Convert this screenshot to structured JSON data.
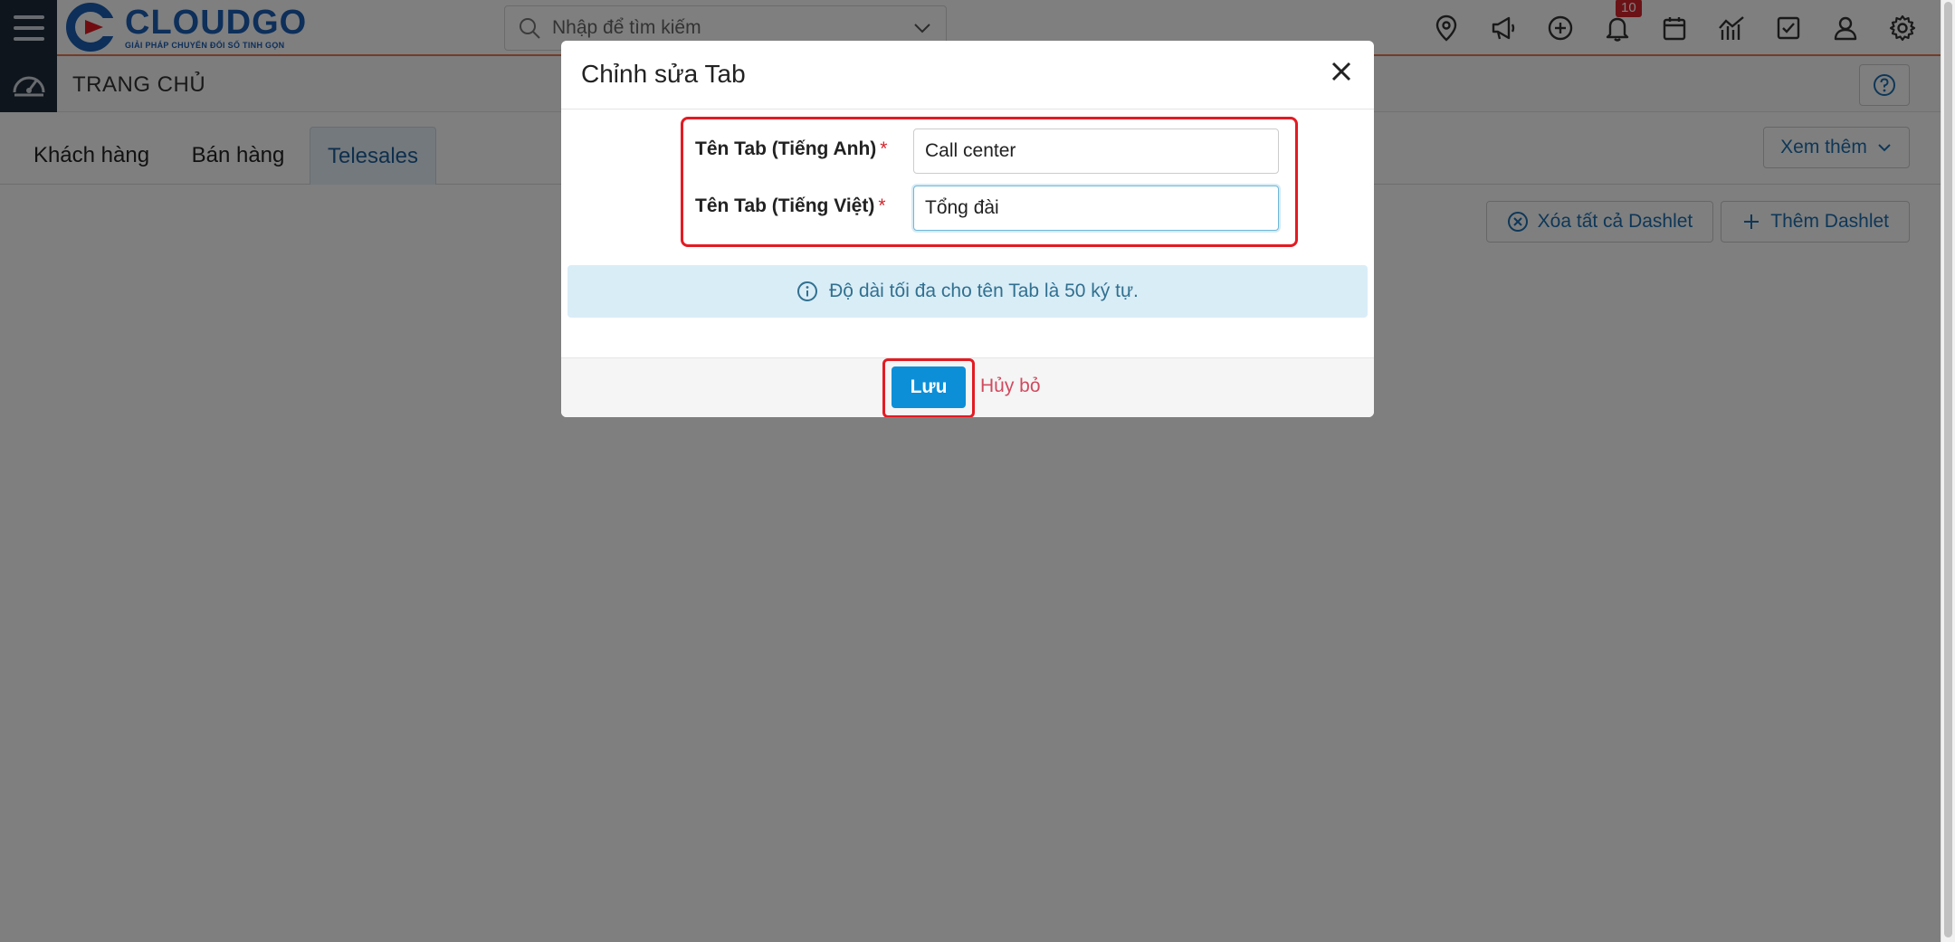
{
  "header": {
    "logo_name": "CLOUDGO",
    "logo_tagline": "GIẢI PHÁP CHUYỂN ĐỔI SỐ TINH GỌN",
    "search_placeholder": "Nhập để tìm kiếm",
    "notification_count": "10",
    "icons": [
      "map-pin-icon",
      "megaphone-icon",
      "plus-circle-icon",
      "bell-icon",
      "calendar-icon",
      "chart-icon",
      "checkbox-icon",
      "user-icon",
      "gear-icon"
    ]
  },
  "breadcrumb": {
    "title": "TRANG CHỦ"
  },
  "tabs": [
    {
      "label": "Khách hàng",
      "active": false
    },
    {
      "label": "Bán hàng",
      "active": false
    },
    {
      "label": "Telesales",
      "active": true
    }
  ],
  "more_label": "Xem thêm",
  "actions": {
    "delete_all": "Xóa tất cả Dashlet",
    "add": "Thêm Dashlet"
  },
  "modal": {
    "title": "Chỉnh sửa Tab",
    "field_en_label": "Tên Tab (Tiếng Anh)",
    "field_en_value": "Call center",
    "field_vi_label": "Tên Tab (Tiếng Việt)",
    "field_vi_value": "Tổng đài",
    "required_mark": "*",
    "info_text": "Độ dài tối đa cho tên Tab là 50 ký tự.",
    "save_label": "Lưu",
    "cancel_label": "Hủy bỏ"
  },
  "colors": {
    "primary": "#0d8fd8",
    "highlight": "#e31b23",
    "info_bg": "#d9edf7",
    "sidebar": "#1f2a3a"
  }
}
